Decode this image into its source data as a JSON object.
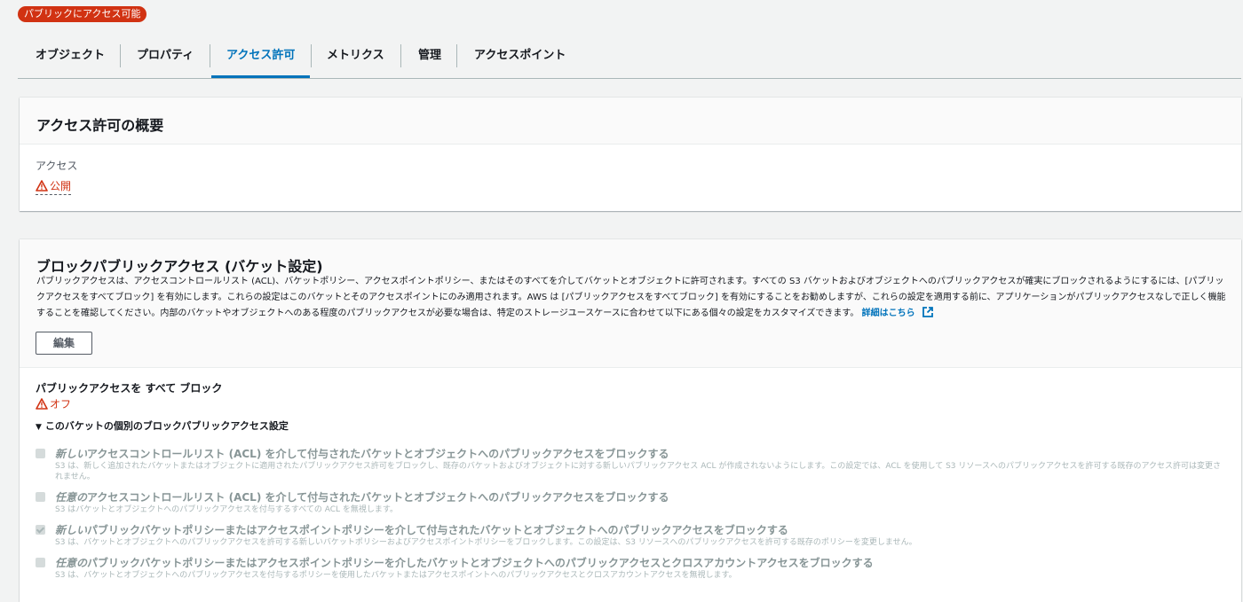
{
  "badge": "パブリックにアクセス可能",
  "tabs": [
    "オブジェクト",
    "プロパティ",
    "アクセス許可",
    "メトリクス",
    "管理",
    "アクセスポイント"
  ],
  "active_tab": "アクセス許可",
  "overview": {
    "title": "アクセス許可の概要",
    "access_label": "アクセス",
    "access_value": "公開"
  },
  "block": {
    "title": "ブロックパブリックアクセス (バケット設定)",
    "description": "パブリックアクセスは、アクセスコントロールリスト (ACL)、バケットポリシー、アクセスポイントポリシー、またはそのすべてを介してバケットとオブジェクトに許可されます。すべての S3 バケットおよびオブジェクトへのパブリックアクセスが確実にブロックされるようにするには、[パブリックアクセスをすべてブロック] を有効にします。これらの設定はこのバケットとそのアクセスポイントにのみ適用されます。AWS は [パブリックアクセスをすべてブロック] を有効にすることをお勧めしますが、これらの設定を適用する前に、アプリケーションがパブリックアクセスなしで正しく機能することを確認してください。内部のバケットやオブジェクトへのある程度のパブリックアクセスが必要な場合は、特定のストレージユースケースに合わせて以下にある個々の設定をカスタマイズできます。",
    "learn_more": "詳細はこちら",
    "edit_button": "編集",
    "all_block_label": "パブリックアクセスを すべて ブロック",
    "all_block_value": "オフ",
    "expander": "このバケットの個別のブロックパブリックアクセス設定",
    "options": [
      {
        "emph": "新しい",
        "title": "アクセスコントロールリスト (ACL) を介して付与されたバケットとオブジェクトへのパブリックアクセスをブロックする",
        "desc": "S3 は、新しく追加されたバケットまたはオブジェクトに適用されたパブリックアクセス許可をブロックし、既存のバケットおよびオブジェクトに対する新しいパブリックアクセス ACL が作成されないようにします。この設定では、ACL を使用して S3 リソースへのパブリックアクセスを許可する既存のアクセス許可は変更されません。",
        "checked": false
      },
      {
        "emph": "任意の",
        "title": "アクセスコントロールリスト (ACL) を介して付与されたバケットとオブジェクトへのパブリックアクセスをブロックする",
        "desc": "S3 はバケットとオブジェクトへのパブリックアクセスを付与するすべての ACL を無視します。",
        "checked": false
      },
      {
        "emph": "新しい",
        "title": "パブリックバケットポリシーまたはアクセスポイントポリシーを介して付与されたバケットとオブジェクトへのパブリックアクセスをブロックする",
        "desc": "S3 は、バケットとオブジェクトへのパブリックアクセスを許可する新しいバケットポリシーおよびアクセスポイントポリシーをブロックします。この設定は、S3 リソースへのパブリックアクセスを許可する既存のポリシーを変更しません。",
        "checked": true
      },
      {
        "emph": "任意の",
        "title": "パブリックバケットポリシーまたはアクセスポイントポリシーを介したバケットとオブジェクトへのパブリックアクセスとクロスアカウントアクセスをブロックする",
        "desc": "S3 は、バケットとオブジェクトへのパブリックアクセスを付与するポリシーを使用したバケットまたはアクセスポイントへのパブリックアクセスとクロスアカウントアクセスを無視します。",
        "checked": false
      }
    ]
  },
  "colors": {
    "accent": "#0073bb",
    "danger": "#d13212"
  },
  "icons": {
    "warning": "warning-icon",
    "external": "external-link-icon",
    "caret": "caret-down-icon"
  }
}
